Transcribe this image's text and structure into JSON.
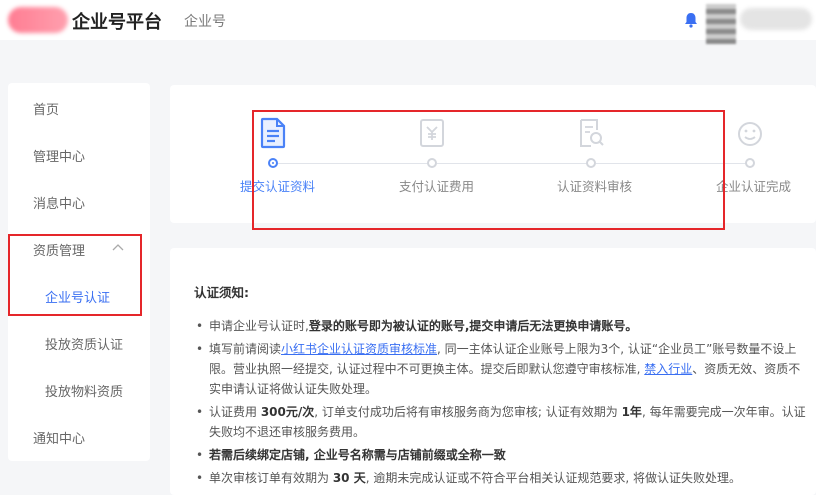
{
  "header": {
    "brand": "企业号平台",
    "subbrand": "企业号"
  },
  "sidebar": {
    "items": [
      {
        "label": "首页"
      },
      {
        "label": "管理中心"
      },
      {
        "label": "消息中心"
      },
      {
        "label": "资质管理"
      },
      {
        "label": "企业号认证"
      },
      {
        "label": "投放资质认证"
      },
      {
        "label": "投放物料资质"
      },
      {
        "label": "通知中心"
      }
    ]
  },
  "steps": [
    {
      "label": "提交认证资料",
      "icon": "document-icon",
      "active": true
    },
    {
      "label": "支付认证费用",
      "icon": "payment-icon",
      "active": false
    },
    {
      "label": "认证资料审核",
      "icon": "review-icon",
      "active": false
    },
    {
      "label": "企业认证完成",
      "icon": "smile-icon",
      "active": false
    }
  ],
  "notice": {
    "title": "认证须知:",
    "items": [
      {
        "pre": "申请企业号认证时,",
        "bold": "登录的账号即为被认证的账号,提交申请后无法更换申请账号。"
      },
      {
        "pre": "填写前请阅读",
        "link": "小红书企业认证资质审核标准",
        "mid": ", 同一主体认证企业账号上限为3个, 认证“企业员工”账号数量不设上限。营业执照一经提交, 认证过程中不可更换主体。提交后即默认您遵守审核标准, ",
        "link2": "禁入行业",
        "post": "、资质无效、资质不实申请认证将做认证失败处理。"
      },
      {
        "pre": "认证费用 ",
        "bold": "300元/次",
        "mid": ", 订单支付成功后将有审核服务商为您审核; 认证有效期为 ",
        "bold2": "1年",
        "post": ", 每年需要完成一次年审。认证失败均不退还审核服务费用。"
      },
      {
        "bold": "若需后续绑定店铺, 企业号名称需与店铺前缀或全称一致"
      },
      {
        "pre": "单次审核订单有效期为 ",
        "bold": "30 天",
        "post": ", 逾期未完成认证或不符合平台相关认证规范要求, 将做认证失败处理。"
      }
    ]
  },
  "colors": {
    "accent": "#4a82f7",
    "highlight_box": "#e5262a"
  }
}
